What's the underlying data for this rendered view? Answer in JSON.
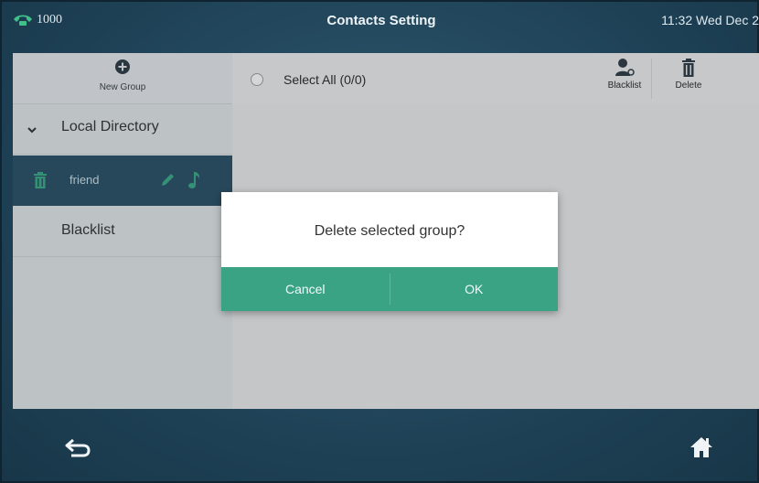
{
  "status": {
    "line_number": "1000",
    "title": "Contacts Setting",
    "clock": "11:32 Wed Dec 2"
  },
  "sidebar": {
    "new_group_label": "New Group",
    "local_directory_label": "Local Directory",
    "friend_label": "friend",
    "blacklist_label": "Blacklist"
  },
  "toolbar": {
    "select_all_label": "Select All (0/0)",
    "blacklist_label": "Blacklist",
    "delete_label": "Delete"
  },
  "dialog": {
    "message": "Delete selected group?",
    "cancel_label": "Cancel",
    "ok_label": "OK"
  },
  "icons": {
    "phone": "phone-handset-icon",
    "new_group": "plus-circle-icon",
    "collapse": "chevron-down-icon",
    "delete": "trash-icon",
    "edit": "pencil-icon",
    "ringtone": "music-note-icon",
    "blacklist": "user-block-icon",
    "back": "back-arrow-icon",
    "home": "home-icon"
  },
  "colors": {
    "accent_green": "#3aa383",
    "selected_row": "#2a4f64",
    "background_dark": "#1f4257"
  }
}
